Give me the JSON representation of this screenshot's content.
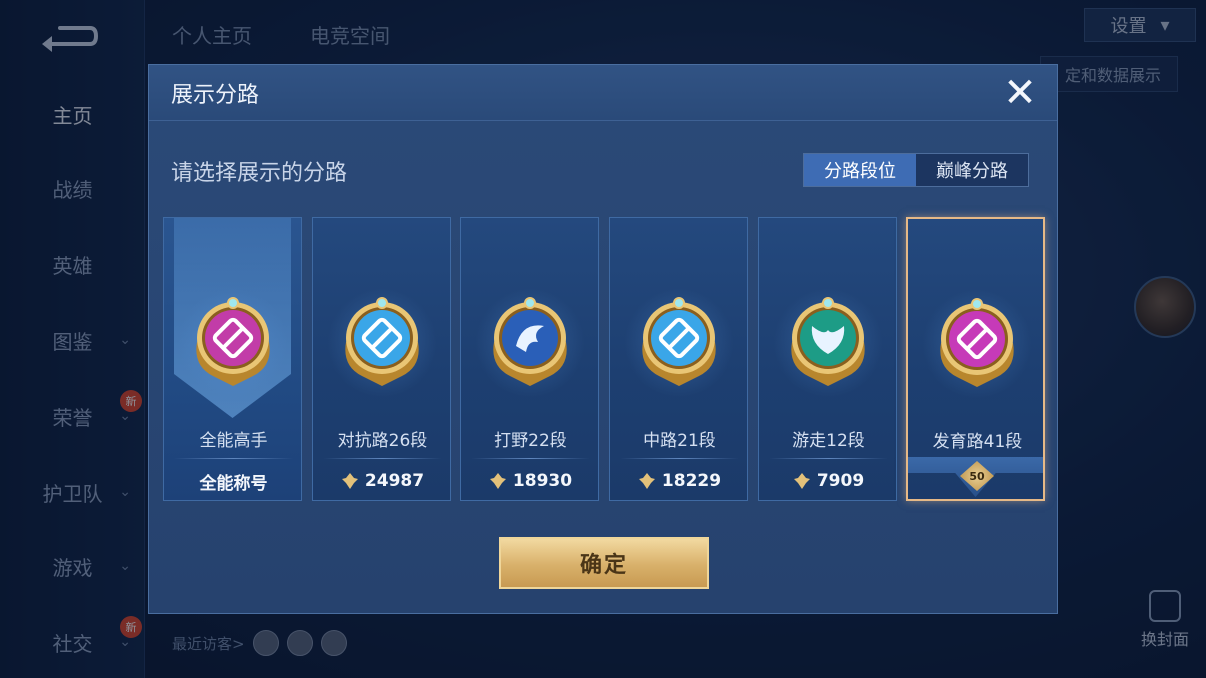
{
  "background": {
    "nav_items": [
      {
        "label": "主页",
        "has_chevron": false,
        "is_new": false
      },
      {
        "label": "战绩",
        "has_chevron": false,
        "is_new": false
      },
      {
        "label": "英雄",
        "has_chevron": false,
        "is_new": false
      },
      {
        "label": "图鉴",
        "has_chevron": true,
        "is_new": false
      },
      {
        "label": "荣誉",
        "has_chevron": true,
        "is_new": true
      },
      {
        "label": "护卫队",
        "has_chevron": true,
        "is_new": false
      },
      {
        "label": "游戏",
        "has_chevron": true,
        "is_new": false
      },
      {
        "label": "社交",
        "has_chevron": true,
        "is_new": true
      }
    ],
    "new_badge": "新",
    "top_tabs": [
      "个人主页",
      "电竞空间"
    ],
    "settings_label": "设置",
    "data_display_label": "定和数据展示",
    "visitors_label": "最近访客>",
    "cover_label": "换封面"
  },
  "modal": {
    "title": "展示分路",
    "prompt": "请选择展示的分路",
    "tabs": [
      {
        "label": "分路段位",
        "active": true
      },
      {
        "label": "巅峰分路",
        "active": false
      }
    ],
    "cards": [
      {
        "name": "全能高手",
        "score": "全能称号",
        "show_flag": false,
        "emblem": "all-rounder-emblem-icon",
        "emblem_color": "#c23ca8"
      },
      {
        "name": "对抗路26段",
        "score": "24987",
        "show_flag": true,
        "emblem": "clash-lane-sword-emblem-icon",
        "emblem_color": "#3aa6e8"
      },
      {
        "name": "打野22段",
        "score": "18930",
        "show_flag": true,
        "emblem": "jungle-dragon-emblem-icon",
        "emblem_color": "#2a5fb8"
      },
      {
        "name": "中路21段",
        "score": "18229",
        "show_flag": true,
        "emblem": "mid-lane-staff-emblem-icon",
        "emblem_color": "#3aa6e8"
      },
      {
        "name": "游走12段",
        "score": "7909",
        "show_flag": true,
        "emblem": "roam-wings-emblem-icon",
        "emblem_color": "#1d9c86"
      },
      {
        "name": "发育路41段",
        "score": "",
        "show_flag": false,
        "emblem": "farm-lane-emblem-icon",
        "emblem_color": "#c63ab8",
        "selected": true,
        "level": "50"
      }
    ],
    "confirm_label": "确定",
    "close_icon": "close-icon"
  },
  "colors": {
    "gold": "#e6b987",
    "accent_blue": "#3e6cb4",
    "modal_bg": "#2b4a78"
  }
}
